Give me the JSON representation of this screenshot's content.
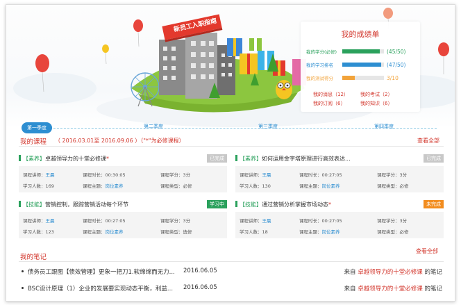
{
  "hero": {
    "banner": "新员工入职指南"
  },
  "score": {
    "title": "我的成绩单",
    "rows": [
      {
        "label": "我的学分(必修)",
        "value": "(45/50)",
        "progress": 0.9,
        "color": "#2aa15c",
        "value_color": "#2aa15c"
      },
      {
        "label": "我的学习排名",
        "value": "(47/50)",
        "progress": 0.94,
        "color": "#2d8ed1",
        "value_color": "#2d8ed1"
      },
      {
        "label": "我的测试得分",
        "value": "3/10",
        "progress": 0.3,
        "color": "#f2a33a",
        "value_color": "#f2a33a"
      }
    ],
    "links": [
      "我的消息（12）",
      "我的考试（2）",
      "我的订阅（6）",
      "我的知识（6）"
    ]
  },
  "timeline": {
    "tabs": [
      "第一季度",
      "第二季度",
      "第三季度",
      "第四季度"
    ]
  },
  "courses": {
    "title": "我的课程",
    "note": "（ 2016.03.01至 2016.09.06 ）（\"*\"为必修课程）",
    "view_all": "查看全部",
    "cards": [
      {
        "tag": "【素养】",
        "name": "卓越领导力的十堂必修课",
        "required": true,
        "status": "已完成",
        "status_color": "#c8c8c8",
        "fields": {
          "teacher_label": "课程讲师：",
          "teacher": "王晨",
          "duration_label": "课程时长：",
          "duration": "00:30:05",
          "credit_label": "课程学分：",
          "credit": "3分",
          "learners_label": "学习人数：",
          "learners": "169",
          "topic_label": "课程主题：",
          "topic": "岗位素养",
          "type_label": "课程类型：",
          "type": "必修"
        }
      },
      {
        "tag": "【素养】",
        "name": "如何运用金字塔原理进行高效表达...",
        "required": false,
        "status": "已完成",
        "status_color": "#c8c8c8",
        "fields": {
          "teacher_label": "课程讲师：",
          "teacher": "王晨",
          "duration_label": "课程时长：",
          "duration": "00:27:05",
          "credit_label": "课程学分：",
          "credit": "3分",
          "learners_label": "学习人数：",
          "learners": "130",
          "topic_label": "课程主题：",
          "topic": "岗位素养",
          "type_label": "课程类型：",
          "type": "必修"
        }
      },
      {
        "tag": "【技能】",
        "name": "营销控制，跟踪营销活动每个环节",
        "required": false,
        "status": "学习中",
        "status_color": "#2aa15c",
        "fields": {
          "teacher_label": "课程讲师：",
          "teacher": "王晨",
          "duration_label": "课程时长：",
          "duration": "00:27:05",
          "credit_label": "课程学分：",
          "credit": "3分",
          "learners_label": "学习人数：",
          "learners": "123",
          "topic_label": "课程主题：",
          "topic": "岗位素养",
          "type_label": "课程类型：",
          "type": "选修"
        }
      },
      {
        "tag": "【技能】",
        "name": "通过营销分析掌握市场动态",
        "required": true,
        "status": "未完成",
        "status_color": "#f28c1e",
        "fields": {
          "teacher_label": "课程讲师：",
          "teacher": "王晨",
          "duration_label": "课程时长：",
          "duration": "00:27:05",
          "credit_label": "课程学分：",
          "credit": "3分",
          "learners_label": "学习人数：",
          "learners": "18",
          "topic_label": "课程主题：",
          "topic": "岗位素养",
          "type_label": "课程类型：",
          "type": "必修"
        }
      }
    ]
  },
  "notes": {
    "title": "我的笔记",
    "view_all": "查看全部",
    "items": [
      {
        "text": "债务员工跟图【债效管理】更象一把刀1.软绵绵而无力...",
        "date": "2016.06.05",
        "from_prefix": "来自",
        "course": "卓越领导力的十堂必修课",
        "from_suffix": "的笔记"
      },
      {
        "text": "BSC设计原理（1）企业的发展要实现动态平衡，利益...",
        "date": "2016.06.05",
        "from_prefix": "来自",
        "course": "卓越领导力的十堂必修课",
        "from_suffix": "的笔记"
      }
    ]
  }
}
